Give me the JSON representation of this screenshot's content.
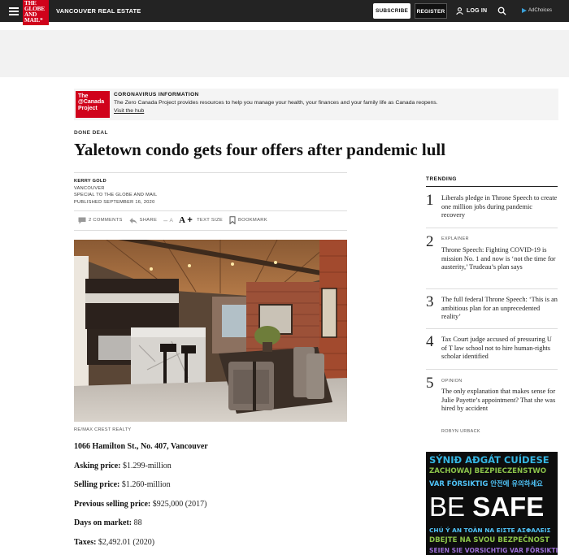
{
  "nav": {
    "logo_lines": [
      "THE",
      "GLOBE",
      "AND",
      "MAIL*"
    ],
    "section": "VANCOUVER REAL ESTATE",
    "subscribe": "SUBSCRIBE",
    "register": "REGISTER",
    "login": "LOG IN",
    "adchoices": "AdChoices"
  },
  "banner": {
    "logo_lines": [
      "The",
      "@Canada",
      "Project"
    ],
    "title": "CORONAVIRUS INFORMATION",
    "text": "The Zero Canada Project provides resources to help you manage your health, your finances and your family life as Canada reopens.",
    "link": "Visit the hub"
  },
  "article": {
    "kicker": "DONE DEAL",
    "headline": "Yaletown condo gets four offers after pandemic lull",
    "author": "KERRY GOLD",
    "location": "VANCOUVER",
    "special": "SPECIAL TO THE GLOBE AND MAIL",
    "published": "PUBLISHED SEPTEMBER 16, 2020",
    "tools": {
      "comments": "2 COMMENTS",
      "share": "SHARE",
      "text_minus": "A",
      "text_plus": "A",
      "text_size": "TEXT SIZE",
      "bookmark": "BOOKMARK"
    },
    "photo_credit": "RE/MAX CREST REALTY",
    "address": "1066 Hamilton St., No. 407, Vancouver",
    "facts": [
      {
        "label": "Asking price:",
        "value": "$1.299-million"
      },
      {
        "label": "Selling price:",
        "value": "$1.260-million"
      },
      {
        "label": "Previous selling price:",
        "value": "$925,000 (2017)"
      },
      {
        "label": "Days on market:",
        "value": "88"
      },
      {
        "label": "Taxes:",
        "value": "$2,492.01 (2020)"
      }
    ]
  },
  "trending": {
    "heading": "TRENDING",
    "items": [
      {
        "num": "1",
        "kicker": "",
        "text": "Liberals pledge in Throne Speech to create one million jobs during pandemic recovery"
      },
      {
        "num": "2",
        "kicker": "EXPLAINER",
        "text": "Throne Speech: Fighting COVID-19 is mission No. 1 and now is ‘not the time for austerity,’ Trudeau’s plan says"
      },
      {
        "num": "3",
        "kicker": "",
        "text": "The full federal Throne Speech: ‘This is an ambitious plan for an unprecedented reality’"
      },
      {
        "num": "4",
        "kicker": "",
        "text": "Tax Court judge accused of pressuring U of T law school not to hire human-rights scholar identified"
      },
      {
        "num": "5",
        "kicker": "OPINION",
        "text": "The only explanation that makes sense for Julie Payette’s appointment? That she was hired by accident"
      }
    ],
    "last_author": "ROBYN URBACK"
  },
  "ad": {
    "lines": [
      {
        "text": "SÝNIÐ AÐGÁT CUÍDESE",
        "color": "#35b6e3"
      },
      {
        "text": "ZACHOWAJ BEZPIECZEŃSTWO",
        "color": "#8bc34a"
      },
      {
        "text": "VAR FÖRSIKTIG 안전에 유의하세요",
        "color": "#4fc3f7"
      },
      {
        "text": "CHÚ Ý AN TOÀN  ΝΑ ΕΙΣΤΕ ΑΣΦΑΛΕΙΣ",
        "color": "#4fc3f7"
      },
      {
        "text": "DBEJTE NA SVOU BEZPEČNOST",
        "color": "#8bc34a"
      },
      {
        "text": "SEIEN SIE VORSICHTIG VAR FÖRSIKTIG",
        "color": "#9c6fd6"
      }
    ],
    "be": "BE",
    "safe": "SAFE"
  },
  "colors": {
    "brand_red": "#d0021b",
    "nav_bg": "#232323"
  }
}
